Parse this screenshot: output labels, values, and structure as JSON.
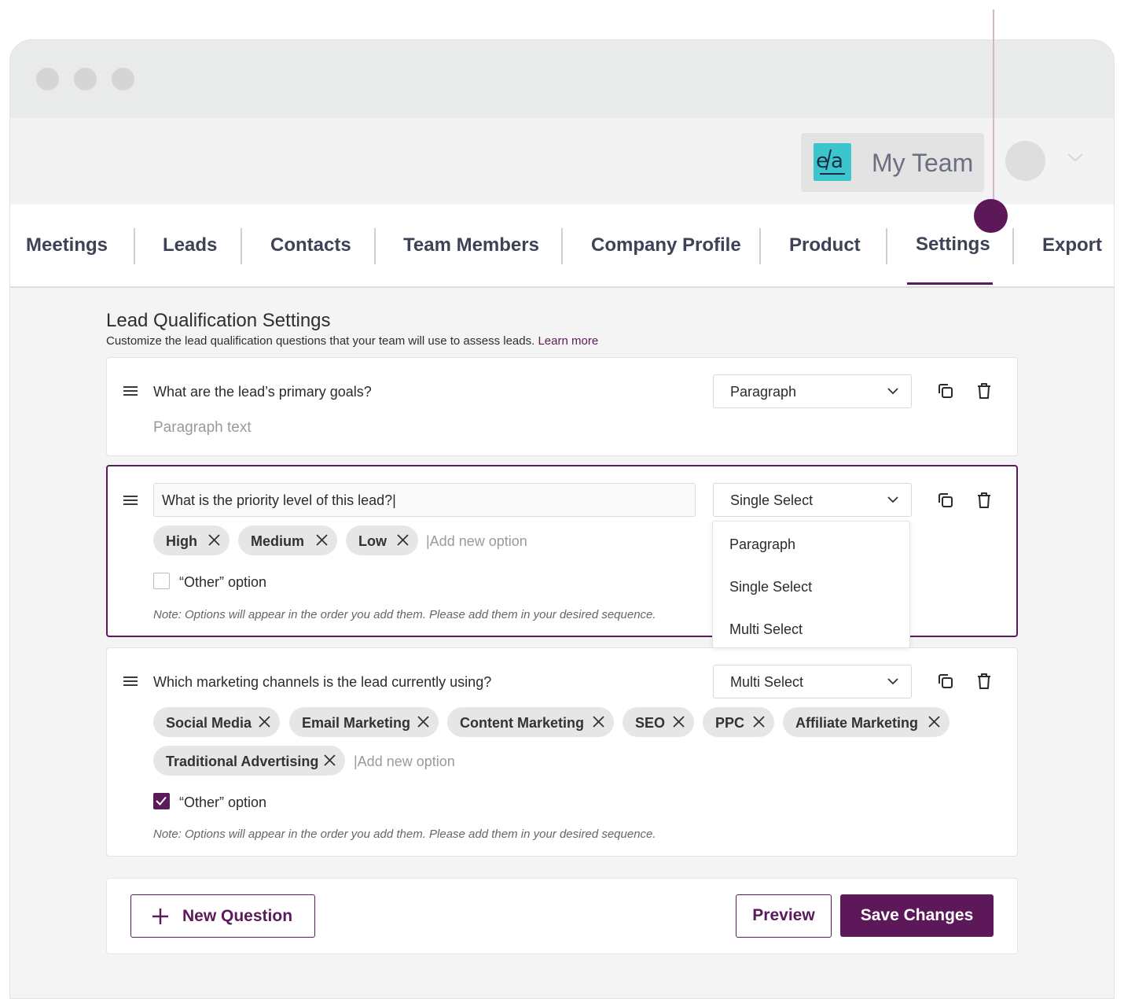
{
  "header": {
    "team_name": "My Team",
    "logo_text": "efa"
  },
  "nav": {
    "tabs": [
      {
        "label": "Meetings"
      },
      {
        "label": "Leads"
      },
      {
        "label": "Contacts"
      },
      {
        "label": "Team Members"
      },
      {
        "label": "Company Profile"
      },
      {
        "label": "Product"
      },
      {
        "label": "Settings",
        "active": true
      },
      {
        "label": "Export"
      }
    ]
  },
  "settings": {
    "title": "Lead Qualification Settings",
    "subtitle": "Customize the lead qualification questions that your team will use to assess leads.",
    "learn_more": "Learn more"
  },
  "questions": [
    {
      "text": "What are the lead’s primary goals?",
      "type": "Paragraph",
      "placeholder": "Paragraph text"
    },
    {
      "text": "What is the priority level of this lead?|",
      "type": "Single Select",
      "options": [
        "High",
        "Medium",
        "Low"
      ],
      "add_option_placeholder": "|Add new option",
      "other_label": "“Other” option",
      "other_checked": false,
      "note": "Note: Options will appear in the order you add them. Please add them in your desired sequence."
    },
    {
      "text": "Which marketing channels is the lead currently using?",
      "type": "Multi Select",
      "options": [
        "Social Media",
        "Email Marketing",
        "Content Marketing",
        "SEO",
        "PPC",
        "Affiliate Marketing",
        "Traditional Advertising"
      ],
      "add_option_placeholder": "|Add new option",
      "other_label": "“Other” option",
      "other_checked": true,
      "note": "Note: Options will appear in the order you add them. Please add them in your desired sequence."
    }
  ],
  "type_dropdown": {
    "options": [
      "Paragraph",
      "Single Select",
      "Multi Select"
    ]
  },
  "footer": {
    "new_question": "New Question",
    "preview": "Preview",
    "save": "Save Changes"
  },
  "colors": {
    "accent": "#5b1a5a",
    "chip_bg": "#e6e6e6",
    "logo_bg": "#3cc6cc"
  }
}
